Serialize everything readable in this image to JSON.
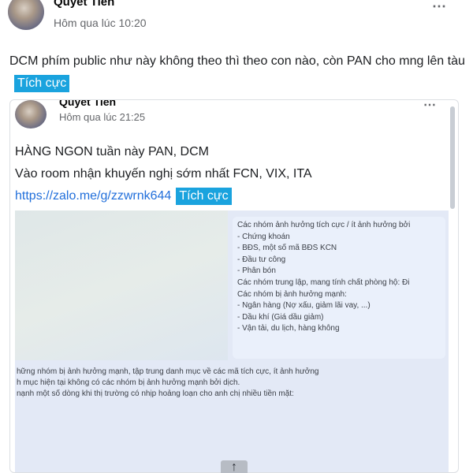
{
  "post": {
    "author": "Quyết Tiến",
    "timestamp": "Hôm qua lúc 10:20",
    "more_icon": "⋯",
    "text": "DCM phím public như này không theo thì theo con nào, còn PAN cho mng lên tàu",
    "tag": "Tích cực"
  },
  "shared": {
    "author": "Quyết Tiến",
    "timestamp": "Hôm qua lúc 21:25",
    "more_icon": "⋯",
    "line1": "HÀNG NGON tuần này PAN, DCM",
    "line2": "Vào room nhận khuyến nghị sớm nhất FCN, VIX, ITA",
    "link": "https://zalo.me/g/zzwrnk644",
    "tag": "Tích cực",
    "list_lines": [
      "Các nhóm ảnh hưởng tích cực / ít ảnh hưởng bởi",
      "- Chứng khoán",
      "- BĐS, một số mã BĐS KCN",
      "- Đầu tư công",
      "- Phân bón",
      "Các nhóm trung lập, mang tính chất phòng hộ: Đi",
      "Các nhóm bị ảnh hưởng mạnh:",
      "- Ngân hàng (Nợ xấu, giảm lãi vay, ...)",
      "- Dầu khí (Giá dầu giảm)",
      "- Vận tải, du lịch, hàng không"
    ],
    "lower_lines": [
      "hững nhóm bị ảnh hưởng mạnh, tập trung danh mục về các mã tích cực, ít ảnh hưởng",
      "h mục hiện tại không có các nhóm bị ảnh hưởng mạnh bởi dịch.",
      "nạnh một số dòng khi thị trường có nhịp hoảng loạn cho anh chị nhiều tiền mặt:"
    ]
  },
  "scroll_up_icon": "↑",
  "colors": {
    "tag_bg": "#1aa3de",
    "link": "#216fdb"
  }
}
